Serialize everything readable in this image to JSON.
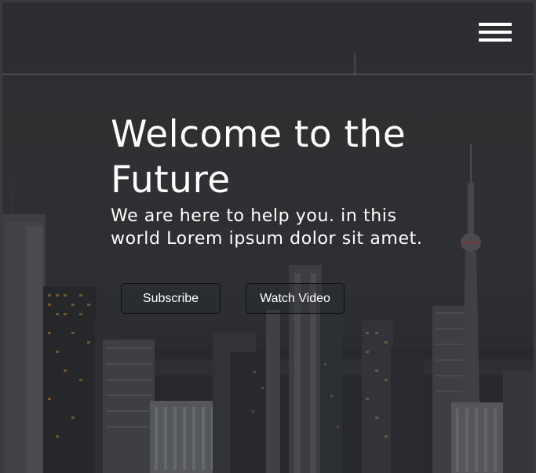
{
  "nav": {
    "menu_icon": "hamburger-menu-icon"
  },
  "hero": {
    "title": "Welcome to the Future",
    "subtitle": "We are here to help you. in this world Lorem ipsum dolor sit amet."
  },
  "buttons": {
    "subscribe_label": "Subscribe",
    "watch_label": "Watch Video"
  },
  "colors": {
    "text": "#ffffff",
    "overlay": "#333437",
    "button_border": "#0e0e0f"
  }
}
